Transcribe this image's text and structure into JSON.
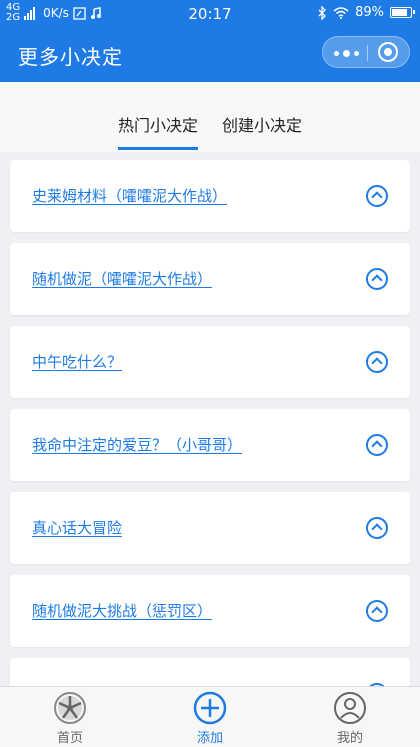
{
  "status_bar": {
    "network_top": "4G",
    "network_bottom": "2G",
    "speed": "0K/s",
    "time": "20:17",
    "battery": "89%",
    "battery_level": 0.89
  },
  "navbar": {
    "title": "更多小决定",
    "more_icon": "more-dots-icon",
    "close_icon": "target-circle-icon"
  },
  "tabs": [
    {
      "label": "热门小决定",
      "active": true
    },
    {
      "label": "创建小决定",
      "active": false
    }
  ],
  "items": [
    {
      "title": "史莱姆材料（嚯嚯泥大作战）"
    },
    {
      "title": "随机做泥（嚯嚯泥大作战）"
    },
    {
      "title": "中午吃什么？"
    },
    {
      "title": "我命中注定的爱豆？（小哥哥）"
    },
    {
      "title": "真心话大冒险"
    },
    {
      "title": "随机做泥大挑战（惩罚区）"
    },
    {
      "title": ""
    }
  ],
  "tab_bar": [
    {
      "label": "首页",
      "icon": "wheel-icon",
      "active": false
    },
    {
      "label": "添加",
      "icon": "plus-circle-icon",
      "active": true
    },
    {
      "label": "我的",
      "icon": "user-icon",
      "active": false
    }
  ],
  "colors": {
    "accent": "#1e7be6",
    "background": "#eef0f4"
  }
}
